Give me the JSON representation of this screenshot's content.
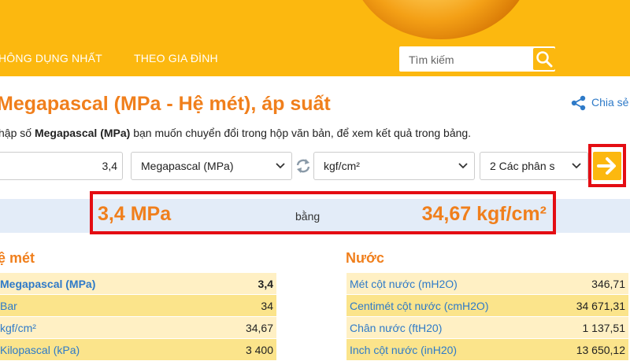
{
  "nav": {
    "items": [
      {
        "label": "HÔNG DỤNG NHẤT"
      },
      {
        "label": "THEO GIA ĐÌNH"
      }
    ]
  },
  "search": {
    "placeholder": "Tìm kiếm"
  },
  "page": {
    "title": "Megapascal (MPa - Hệ mét), áp suất",
    "share_label": "Chia sẻ",
    "instructions_pre": "hập số ",
    "instructions_unit": "Megapascal (MPa)",
    "instructions_post": " bạn muốn chuyển đổi trong hộp văn bản, để xem kết quả trong bảng."
  },
  "converter": {
    "input_value": "3,4",
    "from_unit": "Megapascal (MPa)",
    "to_unit": "kgf/cm²",
    "decimals": "2 Các phân s"
  },
  "result": {
    "from": "3,4 MPa",
    "equals": "bằng",
    "to": "34,67 kgf/cm²"
  },
  "tables": {
    "metric": {
      "title": "ệ mét",
      "rows": [
        {
          "name": "Megapascal (MPa)",
          "value": "3,4"
        },
        {
          "name": "Bar",
          "value": "34"
        },
        {
          "name": "kgf/cm²",
          "value": "34,67"
        },
        {
          "name": "Kilopascal (kPa)",
          "value": "3 400"
        }
      ]
    },
    "water": {
      "title": "Nước",
      "rows": [
        {
          "name": "Mét cột nước (mH2O)",
          "value": "346,71"
        },
        {
          "name": "Centimét cột nước (cmH2O)",
          "value": "34 671,31"
        },
        {
          "name": "Chân nước (ftH20)",
          "value": "1 137,51"
        },
        {
          "name": "Inch cột nước (inH20)",
          "value": "13 650,12"
        }
      ]
    }
  },
  "colors": {
    "brand_yellow": "#fcb80f",
    "accent_orange": "#f07f1c",
    "link_blue": "#2e7ac8",
    "highlight_red": "#e40d13"
  }
}
